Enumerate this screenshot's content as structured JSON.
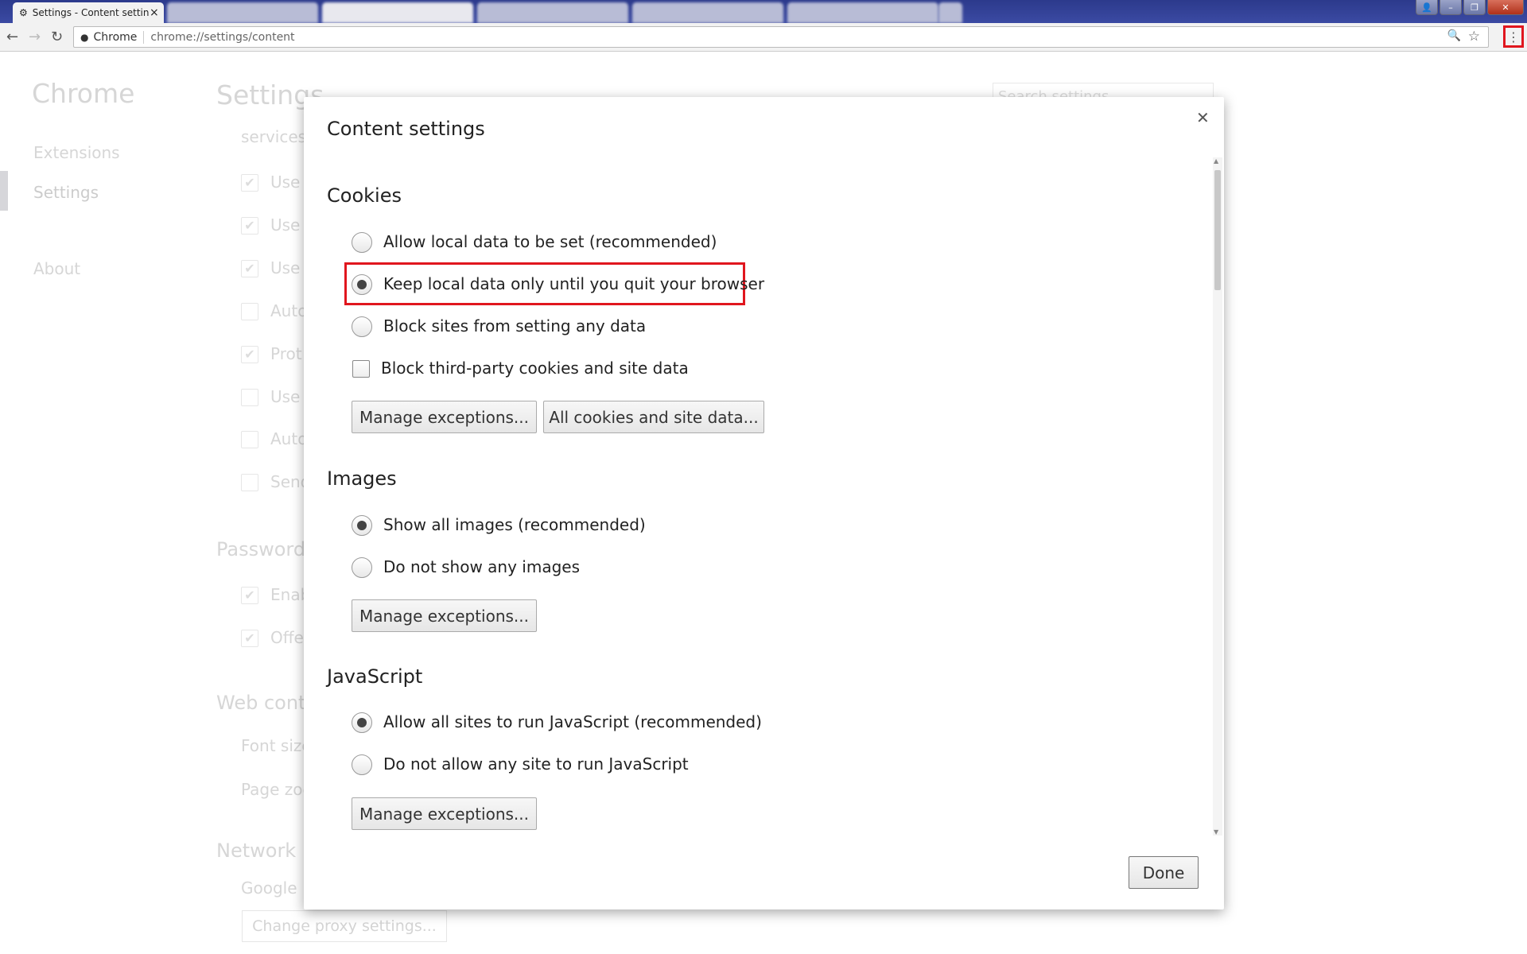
{
  "browser": {
    "active_tab": {
      "title": "Settings - Content settin",
      "close": "×"
    },
    "address": {
      "chip": "Chrome",
      "url": "chrome://settings/content"
    },
    "window_controls": {
      "minimize": "–",
      "restore": "❐",
      "close": "✕"
    },
    "menu_highlight_color": "#e0161e"
  },
  "background": {
    "sidebar": {
      "title": "Chrome",
      "items": [
        "Extensions",
        "Settings",
        "About"
      ]
    },
    "page_title": "Settings",
    "search_placeholder": "Search settings",
    "services_text": "services.",
    "rows": [
      {
        "label": "Use",
        "checked": true
      },
      {
        "label": "Use",
        "checked": true
      },
      {
        "label": "Use",
        "checked": true
      },
      {
        "label": "Auto",
        "checked": false
      },
      {
        "label": "Prot",
        "checked": true
      },
      {
        "label": "Use",
        "checked": false
      },
      {
        "label": "Auto",
        "checked": false
      },
      {
        "label": "Send",
        "checked": false
      }
    ],
    "passwords_heading": "Passwords",
    "password_rows": [
      {
        "label": "Enab",
        "checked": true
      },
      {
        "label": "Offe",
        "checked": true
      }
    ],
    "web_content_heading": "Web cont",
    "font_size": "Font size",
    "page_zoom": "Page zoo",
    "network_heading": "Network",
    "network_text": "Google",
    "proxy_button": "Change proxy settings..."
  },
  "dialog": {
    "title": "Content settings",
    "close": "✕",
    "cookies": {
      "heading": "Cookies",
      "options": [
        {
          "label": "Allow local data to be set (recommended)",
          "selected": false
        },
        {
          "label": "Keep local data only until you quit your browser",
          "selected": true
        },
        {
          "label": "Block sites from setting any data",
          "selected": false
        }
      ],
      "block_third_party": {
        "label": "Block third-party cookies and site data",
        "checked": false
      },
      "manage_exceptions": "Manage exceptions...",
      "all_cookies": "All cookies and site data..."
    },
    "images": {
      "heading": "Images",
      "options": [
        {
          "label": "Show all images (recommended)",
          "selected": true
        },
        {
          "label": "Do not show any images",
          "selected": false
        }
      ],
      "manage_exceptions": "Manage exceptions..."
    },
    "javascript": {
      "heading": "JavaScript",
      "options": [
        {
          "label": "Allow all sites to run JavaScript (recommended)",
          "selected": true
        },
        {
          "label": "Do not allow any site to run JavaScript",
          "selected": false
        }
      ],
      "manage_exceptions": "Manage exceptions..."
    },
    "done": "Done",
    "highlight_color": "#e0161e"
  }
}
